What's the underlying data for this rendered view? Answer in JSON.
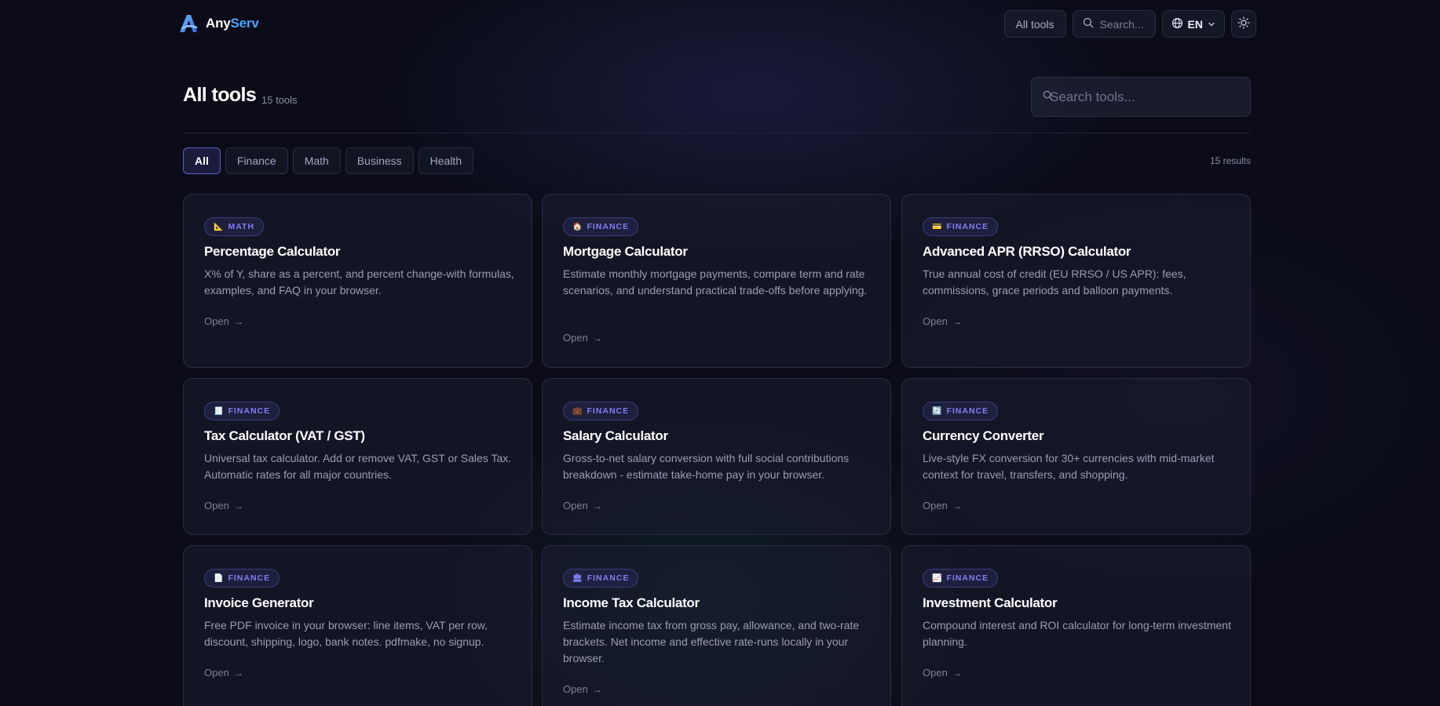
{
  "brand": {
    "name_a": "Any",
    "name_b": "Serv",
    "accent": "#4ea3ff"
  },
  "nav": {
    "all_tools": "All tools",
    "search_placeholder": "Search...",
    "lang": "EN",
    "icons": {
      "search": "search-icon",
      "globe": "globe-icon",
      "chevron": "chevron-down-icon",
      "theme": "sun-icon"
    }
  },
  "header": {
    "title": "All tools",
    "count": "15 tools",
    "search_placeholder": "Search tools..."
  },
  "filters": {
    "items": [
      "All",
      "Finance",
      "Math",
      "Business",
      "Health"
    ],
    "active": "All",
    "results": "15 results"
  },
  "cards": [
    {
      "badge": "MATH",
      "icon": "📐",
      "title": "Percentage Calculator",
      "desc": "X% of Y, share as a percent, and percent change-with formulas, examples, and FAQ in your browser.",
      "open": "Open"
    },
    {
      "badge": "FINANCE",
      "icon": "🏠",
      "title": "Mortgage Calculator",
      "desc": "Estimate monthly mortgage payments, compare term and rate scenarios, and understand practical trade-offs before applying.",
      "open": "Open"
    },
    {
      "badge": "FINANCE",
      "icon": "💳",
      "title": "Advanced APR (RRSO) Calculator",
      "desc": "True annual cost of credit (EU RRSO / US APR): fees, commissions, grace periods and balloon payments.",
      "open": "Open"
    },
    {
      "badge": "FINANCE",
      "icon": "🧾",
      "title": "Tax Calculator (VAT / GST)",
      "desc": "Universal tax calculator. Add or remove VAT, GST or Sales Tax. Automatic rates for all major countries.",
      "open": "Open"
    },
    {
      "badge": "FINANCE",
      "icon": "💼",
      "title": "Salary Calculator",
      "desc": "Gross-to-net salary conversion with full social contributions breakdown - estimate take-home pay in your browser.",
      "open": "Open"
    },
    {
      "badge": "FINANCE",
      "icon": "🔄",
      "title": "Currency Converter",
      "desc": "Live-style FX conversion for 30+ currencies with mid-market context for travel, transfers, and shopping.",
      "open": "Open"
    },
    {
      "badge": "FINANCE",
      "icon": "📄",
      "title": "Invoice Generator",
      "desc": "Free PDF invoice in your browser: line items, VAT per row, discount, shipping, logo, bank notes. pdfmake, no signup.",
      "open": "Open"
    },
    {
      "badge": "FINANCE",
      "icon": "🏛",
      "title": "Income Tax Calculator",
      "desc": "Estimate income tax from gross pay, allowance, and two-rate brackets. Net income and effective rate-runs locally in your browser.",
      "open": "Open"
    },
    {
      "badge": "FINANCE",
      "icon": "📈",
      "title": "Investment Calculator",
      "desc": "Compound interest and ROI calculator for long-term investment planning.",
      "open": "Open"
    }
  ]
}
